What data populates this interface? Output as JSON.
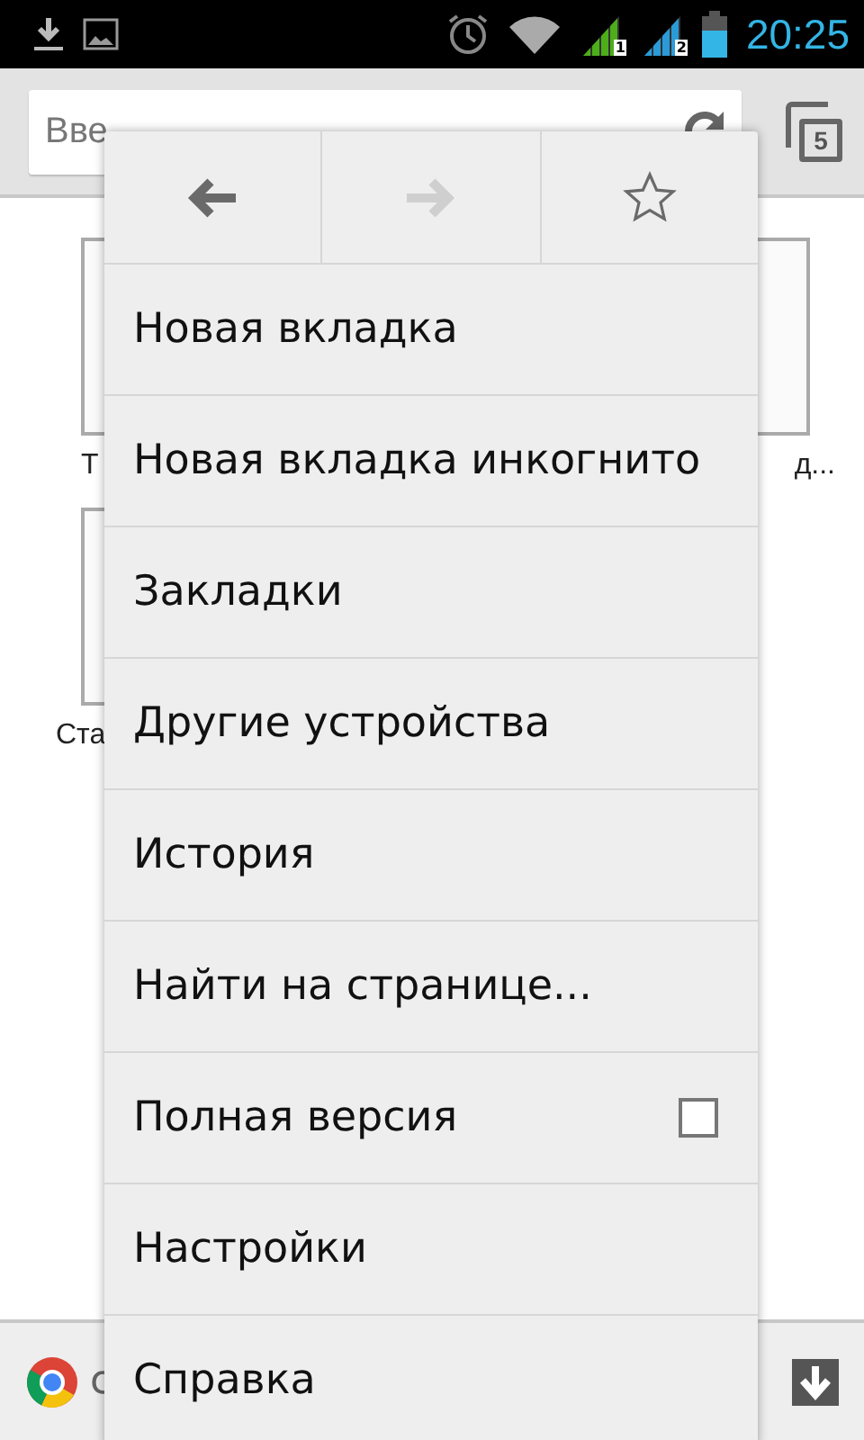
{
  "status_bar": {
    "time": "20:25",
    "sim_badges": [
      "1",
      "2"
    ]
  },
  "toolbar": {
    "url_field": {
      "placeholder": "Вве"
    },
    "tab_count": "5"
  },
  "tiles": [
    {
      "caption": "Т"
    },
    {
      "caption": "д..."
    },
    {
      "caption": "Ста"
    }
  ],
  "bottom_bar": {
    "text": "с"
  },
  "menu": {
    "nav": [
      {
        "kind": "back",
        "disabled": false
      },
      {
        "kind": "forward",
        "disabled": true
      },
      {
        "kind": "bookmark",
        "disabled": false
      }
    ],
    "items": [
      {
        "label": "Новая вкладка",
        "kind": "plain"
      },
      {
        "label": "Новая вкладка инкогнито",
        "kind": "plain"
      },
      {
        "label": "Закладки",
        "kind": "plain"
      },
      {
        "label": "Другие устройства",
        "kind": "plain"
      },
      {
        "label": "История",
        "kind": "plain"
      },
      {
        "label": "Найти на странице...",
        "kind": "plain"
      },
      {
        "label": "Полная версия",
        "kind": "checkbox",
        "checked": false
      },
      {
        "label": "Настройки",
        "kind": "plain"
      },
      {
        "label": "Справка",
        "kind": "plain"
      }
    ]
  }
}
